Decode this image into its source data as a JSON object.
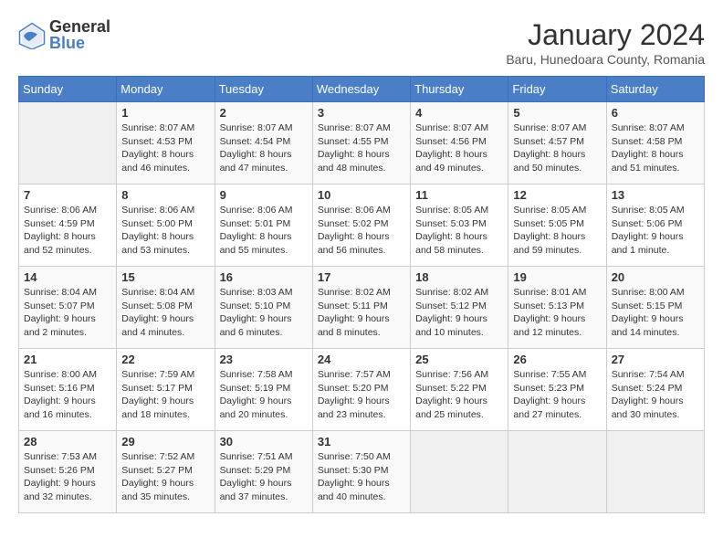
{
  "header": {
    "logo": {
      "text_general": "General",
      "text_blue": "Blue"
    },
    "title": "January 2024",
    "subtitle": "Baru, Hunedoara County, Romania"
  },
  "weekdays": [
    "Sunday",
    "Monday",
    "Tuesday",
    "Wednesday",
    "Thursday",
    "Friday",
    "Saturday"
  ],
  "weeks": [
    [
      {
        "day": "",
        "sunrise": "",
        "sunset": "",
        "daylight": ""
      },
      {
        "day": "1",
        "sunrise": "Sunrise: 8:07 AM",
        "sunset": "Sunset: 4:53 PM",
        "daylight": "Daylight: 8 hours and 46 minutes."
      },
      {
        "day": "2",
        "sunrise": "Sunrise: 8:07 AM",
        "sunset": "Sunset: 4:54 PM",
        "daylight": "Daylight: 8 hours and 47 minutes."
      },
      {
        "day": "3",
        "sunrise": "Sunrise: 8:07 AM",
        "sunset": "Sunset: 4:55 PM",
        "daylight": "Daylight: 8 hours and 48 minutes."
      },
      {
        "day": "4",
        "sunrise": "Sunrise: 8:07 AM",
        "sunset": "Sunset: 4:56 PM",
        "daylight": "Daylight: 8 hours and 49 minutes."
      },
      {
        "day": "5",
        "sunrise": "Sunrise: 8:07 AM",
        "sunset": "Sunset: 4:57 PM",
        "daylight": "Daylight: 8 hours and 50 minutes."
      },
      {
        "day": "6",
        "sunrise": "Sunrise: 8:07 AM",
        "sunset": "Sunset: 4:58 PM",
        "daylight": "Daylight: 8 hours and 51 minutes."
      }
    ],
    [
      {
        "day": "7",
        "sunrise": "Sunrise: 8:06 AM",
        "sunset": "Sunset: 4:59 PM",
        "daylight": "Daylight: 8 hours and 52 minutes."
      },
      {
        "day": "8",
        "sunrise": "Sunrise: 8:06 AM",
        "sunset": "Sunset: 5:00 PM",
        "daylight": "Daylight: 8 hours and 53 minutes."
      },
      {
        "day": "9",
        "sunrise": "Sunrise: 8:06 AM",
        "sunset": "Sunset: 5:01 PM",
        "daylight": "Daylight: 8 hours and 55 minutes."
      },
      {
        "day": "10",
        "sunrise": "Sunrise: 8:06 AM",
        "sunset": "Sunset: 5:02 PM",
        "daylight": "Daylight: 8 hours and 56 minutes."
      },
      {
        "day": "11",
        "sunrise": "Sunrise: 8:05 AM",
        "sunset": "Sunset: 5:03 PM",
        "daylight": "Daylight: 8 hours and 58 minutes."
      },
      {
        "day": "12",
        "sunrise": "Sunrise: 8:05 AM",
        "sunset": "Sunset: 5:05 PM",
        "daylight": "Daylight: 8 hours and 59 minutes."
      },
      {
        "day": "13",
        "sunrise": "Sunrise: 8:05 AM",
        "sunset": "Sunset: 5:06 PM",
        "daylight": "Daylight: 9 hours and 1 minute."
      }
    ],
    [
      {
        "day": "14",
        "sunrise": "Sunrise: 8:04 AM",
        "sunset": "Sunset: 5:07 PM",
        "daylight": "Daylight: 9 hours and 2 minutes."
      },
      {
        "day": "15",
        "sunrise": "Sunrise: 8:04 AM",
        "sunset": "Sunset: 5:08 PM",
        "daylight": "Daylight: 9 hours and 4 minutes."
      },
      {
        "day": "16",
        "sunrise": "Sunrise: 8:03 AM",
        "sunset": "Sunset: 5:10 PM",
        "daylight": "Daylight: 9 hours and 6 minutes."
      },
      {
        "day": "17",
        "sunrise": "Sunrise: 8:02 AM",
        "sunset": "Sunset: 5:11 PM",
        "daylight": "Daylight: 9 hours and 8 minutes."
      },
      {
        "day": "18",
        "sunrise": "Sunrise: 8:02 AM",
        "sunset": "Sunset: 5:12 PM",
        "daylight": "Daylight: 9 hours and 10 minutes."
      },
      {
        "day": "19",
        "sunrise": "Sunrise: 8:01 AM",
        "sunset": "Sunset: 5:13 PM",
        "daylight": "Daylight: 9 hours and 12 minutes."
      },
      {
        "day": "20",
        "sunrise": "Sunrise: 8:00 AM",
        "sunset": "Sunset: 5:15 PM",
        "daylight": "Daylight: 9 hours and 14 minutes."
      }
    ],
    [
      {
        "day": "21",
        "sunrise": "Sunrise: 8:00 AM",
        "sunset": "Sunset: 5:16 PM",
        "daylight": "Daylight: 9 hours and 16 minutes."
      },
      {
        "day": "22",
        "sunrise": "Sunrise: 7:59 AM",
        "sunset": "Sunset: 5:17 PM",
        "daylight": "Daylight: 9 hours and 18 minutes."
      },
      {
        "day": "23",
        "sunrise": "Sunrise: 7:58 AM",
        "sunset": "Sunset: 5:19 PM",
        "daylight": "Daylight: 9 hours and 20 minutes."
      },
      {
        "day": "24",
        "sunrise": "Sunrise: 7:57 AM",
        "sunset": "Sunset: 5:20 PM",
        "daylight": "Daylight: 9 hours and 23 minutes."
      },
      {
        "day": "25",
        "sunrise": "Sunrise: 7:56 AM",
        "sunset": "Sunset: 5:22 PM",
        "daylight": "Daylight: 9 hours and 25 minutes."
      },
      {
        "day": "26",
        "sunrise": "Sunrise: 7:55 AM",
        "sunset": "Sunset: 5:23 PM",
        "daylight": "Daylight: 9 hours and 27 minutes."
      },
      {
        "day": "27",
        "sunrise": "Sunrise: 7:54 AM",
        "sunset": "Sunset: 5:24 PM",
        "daylight": "Daylight: 9 hours and 30 minutes."
      }
    ],
    [
      {
        "day": "28",
        "sunrise": "Sunrise: 7:53 AM",
        "sunset": "Sunset: 5:26 PM",
        "daylight": "Daylight: 9 hours and 32 minutes."
      },
      {
        "day": "29",
        "sunrise": "Sunrise: 7:52 AM",
        "sunset": "Sunset: 5:27 PM",
        "daylight": "Daylight: 9 hours and 35 minutes."
      },
      {
        "day": "30",
        "sunrise": "Sunrise: 7:51 AM",
        "sunset": "Sunset: 5:29 PM",
        "daylight": "Daylight: 9 hours and 37 minutes."
      },
      {
        "day": "31",
        "sunrise": "Sunrise: 7:50 AM",
        "sunset": "Sunset: 5:30 PM",
        "daylight": "Daylight: 9 hours and 40 minutes."
      },
      {
        "day": "",
        "sunrise": "",
        "sunset": "",
        "daylight": ""
      },
      {
        "day": "",
        "sunrise": "",
        "sunset": "",
        "daylight": ""
      },
      {
        "day": "",
        "sunrise": "",
        "sunset": "",
        "daylight": ""
      }
    ]
  ]
}
